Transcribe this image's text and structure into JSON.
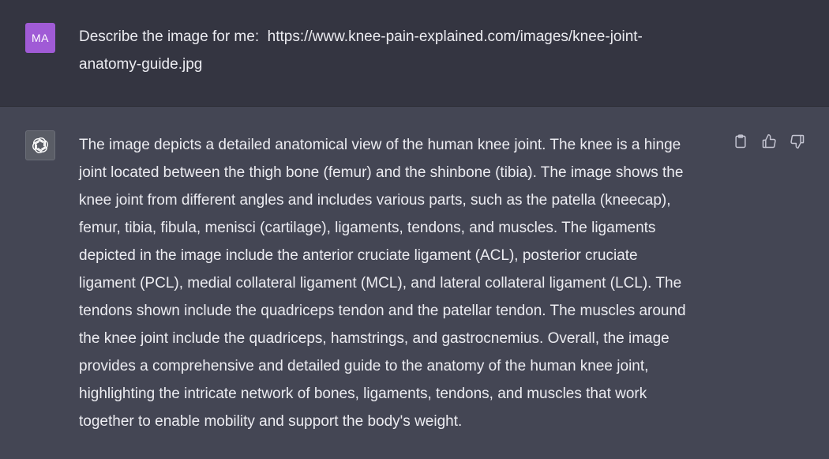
{
  "user": {
    "avatar_initials": "MA",
    "message": "Describe the image for me:  https://www.knee-pain-explained.com/images/knee-joint-\nanatomy-guide.jpg"
  },
  "assistant": {
    "avatar_icon": "openai-logo-icon",
    "message": "The image depicts a detailed anatomical view of the human knee joint. The knee is a hinge\njoint located between the thigh bone (femur) and the shinbone (tibia). The image shows the\nknee joint from different angles and includes various parts, such as the patella (kneecap),\nfemur, tibia, fibula, menisci (cartilage), ligaments, tendons, and muscles. The ligaments\ndepicted in the image include the anterior cruciate ligament (ACL), posterior cruciate\nligament (PCL), medial collateral ligament (MCL), and lateral collateral ligament (LCL). The\ntendons shown include the quadriceps tendon and the patellar tendon. The muscles around\nthe knee joint include the quadriceps, hamstrings, and gastrocnemius. Overall, the image\nprovides a comprehensive and detailed guide to the anatomy of the human knee joint,\nhighlighting the intricate network of bones, ligaments, tendons, and muscles that work\ntogether to enable mobility and support the body's weight.",
    "actions": [
      "clipboard-icon",
      "thumbs-up-icon",
      "thumbs-down-icon"
    ]
  },
  "colors": {
    "user_bg": "#343541",
    "assistant_bg": "#444654",
    "user_avatar": "#a05bd6",
    "text": "#ececf1"
  }
}
